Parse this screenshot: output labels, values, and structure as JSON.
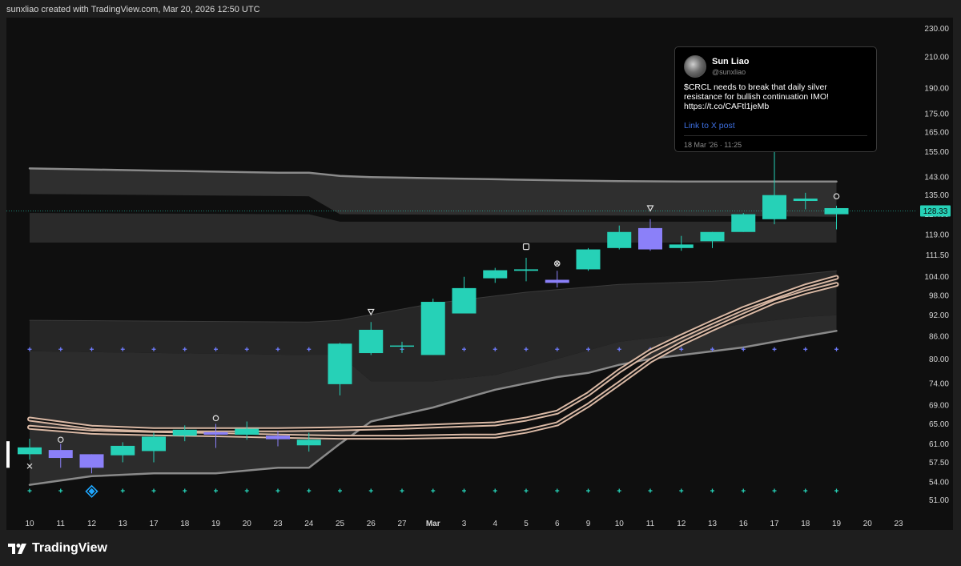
{
  "header": {
    "text": "sunxliao created with TradingView.com, Mar 20, 2026 12:50 UTC"
  },
  "brand": {
    "name": "TradingView",
    "icon": "tradingview-logo-icon"
  },
  "tweet": {
    "author": "Sun Liao",
    "handle": "@sunxliao",
    "text": "$CRCL needs to break that daily silver resistance for bullish continuation IMO! https://t.co/CAFtl1jeMb",
    "link_label": "Link to X post",
    "date": "18 Mar '26 · 11:25"
  },
  "colors": {
    "background": "#0f0f0f",
    "bull": "#26d1b7",
    "bear": "#8b80f9",
    "cloud": "#333333",
    "band_line": "#8a8a8a",
    "ma_outer": "#d9b8a4",
    "ma_inner": "#111111",
    "price_label_bg": "#26d1b7",
    "axis_text": "#d4d4d4",
    "dot_blue": "#6f7cff",
    "dot_teal": "#26d1b7"
  },
  "chart_data": {
    "type": "candlestick",
    "title": "",
    "x": [
      "10",
      "11",
      "12",
      "13",
      "17",
      "18",
      "19",
      "20",
      "23",
      "24",
      "25",
      "26",
      "27",
      "Mar",
      "3",
      "4",
      "5",
      "6",
      "9",
      "10",
      "11",
      "12",
      "13",
      "16",
      "17",
      "18",
      "19"
    ],
    "x_ticks": [
      "10",
      "11",
      "12",
      "13",
      "17",
      "18",
      "19",
      "20",
      "23",
      "24",
      "25",
      "26",
      "27",
      "Mar",
      "3",
      "4",
      "5",
      "6",
      "9",
      "10",
      "11",
      "12",
      "13",
      "16",
      "17",
      "18",
      "19",
      "20",
      "23"
    ],
    "y_ticks": [
      51,
      54,
      57.5,
      61,
      65,
      69,
      74,
      80,
      86,
      92,
      98,
      104,
      111.5,
      119,
      127,
      135,
      143,
      155,
      165,
      175,
      190,
      210,
      230
    ],
    "y_tick_labels": [
      "51.00",
      "54.00",
      "57.50",
      "61.00",
      "65.00",
      "69.00",
      "74.00",
      "80.00",
      "86.00",
      "92.00",
      "98.00",
      "104.00",
      "111.50",
      "119.00",
      "127.00",
      "135.00",
      "143.00",
      "155.00",
      "165.00",
      "175.00",
      "190.00",
      "210.00",
      "230.00"
    ],
    "y_scale": "log",
    "ylim": [
      49,
      238
    ],
    "last_price": 128.33,
    "last_price_label": "128.33",
    "candles": [
      {
        "o": 59.0,
        "h": 62.0,
        "l": 58.0,
        "c": 60.3
      },
      {
        "o": 59.8,
        "h": 61.0,
        "l": 56.5,
        "c": 58.3
      },
      {
        "o": 59.0,
        "h": 59.0,
        "l": 55.5,
        "c": 56.5
      },
      {
        "o": 58.8,
        "h": 61.3,
        "l": 57.5,
        "c": 60.6
      },
      {
        "o": 59.6,
        "h": 63.2,
        "l": 57.5,
        "c": 62.4
      },
      {
        "o": 62.6,
        "h": 64.7,
        "l": 61.5,
        "c": 63.8
      },
      {
        "o": 63.3,
        "h": 65.0,
        "l": 60.2,
        "c": 62.8
      },
      {
        "o": 62.8,
        "h": 65.5,
        "l": 61.8,
        "c": 64.0
      },
      {
        "o": 62.6,
        "h": 63.5,
        "l": 60.5,
        "c": 61.9
      },
      {
        "o": 60.7,
        "h": 63.2,
        "l": 59.5,
        "c": 61.8
      },
      {
        "o": 73.8,
        "h": 84.2,
        "l": 71.2,
        "c": 84.0
      },
      {
        "o": 81.5,
        "h": 90.0,
        "l": 81.0,
        "c": 87.8
      },
      {
        "o": 83.5,
        "h": 84.5,
        "l": 81.5,
        "c": 83.5
      },
      {
        "o": 81.0,
        "h": 97.0,
        "l": 81.0,
        "c": 96.0
      },
      {
        "o": 92.5,
        "h": 104.0,
        "l": 92.5,
        "c": 100.3
      },
      {
        "o": 103.5,
        "h": 107.0,
        "l": 102.0,
        "c": 106.2
      },
      {
        "o": 106.0,
        "h": 110.5,
        "l": 102.5,
        "c": 106.5
      },
      {
        "o": 103.0,
        "h": 106.0,
        "l": 100.5,
        "c": 102.0
      },
      {
        "o": 106.5,
        "h": 114.0,
        "l": 106.0,
        "c": 113.5
      },
      {
        "o": 114.0,
        "h": 122.5,
        "l": 113.5,
        "c": 120.0
      },
      {
        "o": 121.5,
        "h": 125.0,
        "l": 113.0,
        "c": 113.5
      },
      {
        "o": 114.0,
        "h": 118.5,
        "l": 113.0,
        "c": 115.3
      },
      {
        "o": 116.5,
        "h": 120.0,
        "l": 114.0,
        "c": 120.0
      },
      {
        "o": 120.0,
        "h": 127.5,
        "l": 120.0,
        "c": 127.0
      },
      {
        "o": 125.0,
        "h": 160.0,
        "l": 123.0,
        "c": 135.0
      },
      {
        "o": 132.5,
        "h": 136.0,
        "l": 129.0,
        "c": 133.5
      },
      {
        "o": 127.0,
        "h": 130.5,
        "l": 121.0,
        "c": 129.5
      }
    ],
    "cloud_upper": [
      [
        0,
        147.0
      ],
      [
        2,
        146.5
      ],
      [
        4,
        146.0
      ],
      [
        6,
        145.5
      ],
      [
        8,
        145.0
      ],
      [
        9,
        145.0
      ],
      [
        10,
        143.5
      ],
      [
        11,
        143.0
      ],
      [
        13,
        142.5
      ],
      [
        15,
        142.0
      ],
      [
        17,
        141.5
      ],
      [
        19,
        141.2
      ],
      [
        21,
        141.0
      ],
      [
        23,
        141.0
      ],
      [
        25,
        141.0
      ],
      [
        26,
        141.0
      ]
    ],
    "cloud_upper_lower": [
      [
        0,
        135.5
      ],
      [
        9,
        134.5
      ],
      [
        10,
        127.0
      ],
      [
        26,
        126.0
      ]
    ],
    "cloud_mid_upper": [
      [
        0,
        127.5
      ],
      [
        9,
        127.0
      ],
      [
        10,
        124.0
      ],
      [
        26,
        124.0
      ]
    ],
    "cloud_mid_lower": [
      [
        0,
        116.0
      ],
      [
        9,
        116.0
      ],
      [
        10,
        116.0
      ],
      [
        26,
        116.0
      ]
    ],
    "band_mid_upper": [
      [
        0,
        90.5
      ],
      [
        9,
        90.0
      ],
      [
        10,
        90.5
      ],
      [
        13,
        95.5
      ],
      [
        16,
        99.0
      ],
      [
        19,
        101.5
      ],
      [
        22,
        102.5
      ],
      [
        24,
        104.0
      ],
      [
        26,
        106.0
      ]
    ],
    "band_mid_lower": [
      [
        0,
        82.0
      ],
      [
        9,
        81.0
      ],
      [
        10,
        81.0
      ],
      [
        11,
        74.5
      ],
      [
        13,
        74.5
      ],
      [
        15,
        76.0
      ],
      [
        17,
        80.0
      ],
      [
        19,
        84.5
      ],
      [
        21,
        86.5
      ],
      [
        23,
        89.5
      ],
      [
        25,
        91.5
      ],
      [
        26,
        92.0
      ]
    ],
    "band_lower": [
      [
        0,
        53.5
      ],
      [
        2,
        55.0
      ],
      [
        4,
        55.5
      ],
      [
        6,
        55.5
      ],
      [
        8,
        56.5
      ],
      [
        9,
        56.5
      ],
      [
        10,
        61.0
      ],
      [
        11,
        65.5
      ],
      [
        12,
        67.0
      ],
      [
        13,
        68.5
      ],
      [
        14,
        70.5
      ],
      [
        15,
        72.5
      ],
      [
        16,
        74.0
      ],
      [
        17,
        75.5
      ],
      [
        18,
        76.5
      ],
      [
        19,
        78.5
      ],
      [
        20,
        80.0
      ],
      [
        21,
        81.0
      ],
      [
        22,
        82.0
      ],
      [
        23,
        83.0
      ],
      [
        24,
        84.5
      ],
      [
        25,
        86.0
      ],
      [
        26,
        87.5
      ]
    ],
    "ma_fast": [
      [
        0,
        66.0
      ],
      [
        2,
        64.3
      ],
      [
        4,
        63.8
      ],
      [
        6,
        63.8
      ],
      [
        8,
        63.8
      ],
      [
        10,
        64.0
      ],
      [
        12,
        64.3
      ],
      [
        14,
        64.8
      ],
      [
        15,
        65.0
      ],
      [
        16,
        66.0
      ],
      [
        17,
        67.5
      ],
      [
        18,
        71.5
      ],
      [
        19,
        77.0
      ],
      [
        20,
        82.0
      ],
      [
        21,
        86.0
      ],
      [
        22,
        90.0
      ],
      [
        23,
        94.0
      ],
      [
        24,
        97.5
      ],
      [
        25,
        101.0
      ],
      [
        26,
        103.8
      ]
    ],
    "ma_slow": [
      [
        0,
        64.3
      ],
      [
        2,
        63.3
      ],
      [
        4,
        63.0
      ],
      [
        6,
        62.8
      ],
      [
        8,
        62.5
      ],
      [
        10,
        62.3
      ],
      [
        12,
        62.3
      ],
      [
        14,
        62.5
      ],
      [
        15,
        62.5
      ],
      [
        16,
        63.5
      ],
      [
        17,
        65.0
      ],
      [
        18,
        69.0
      ],
      [
        19,
        74.0
      ],
      [
        20,
        79.5
      ],
      [
        21,
        84.0
      ],
      [
        22,
        88.0
      ],
      [
        23,
        92.0
      ],
      [
        24,
        96.0
      ],
      [
        25,
        99.0
      ],
      [
        26,
        101.5
      ]
    ],
    "markers": [
      {
        "i": 0,
        "price": 56.8,
        "symbol": "x",
        "color": "#e0e0e0"
      },
      {
        "i": 1,
        "price": 61.8,
        "symbol": "circle",
        "color": "#e0e0e0"
      },
      {
        "i": 6,
        "price": 66.2,
        "symbol": "circle",
        "color": "#e0e0e0"
      },
      {
        "i": 11,
        "price": 93.0,
        "symbol": "triangle-down",
        "color": "#e0e0e0"
      },
      {
        "i": 16,
        "price": 114.5,
        "symbol": "square",
        "color": "#e0e0e0"
      },
      {
        "i": 17,
        "price": 108.5,
        "symbol": "circle-x",
        "color": "#e0e0e0"
      },
      {
        "i": 20,
        "price": 129.5,
        "symbol": "triangle-down",
        "color": "#e0e0e0"
      },
      {
        "i": 26,
        "price": 134.5,
        "symbol": "circle",
        "color": "#e0e0e0"
      }
    ],
    "diamond_marker": {
      "i": 2,
      "price": 52.4,
      "color": "#1fa7ff"
    },
    "dots_upper_level": 82.5,
    "dots_lower_level": 52.5
  }
}
